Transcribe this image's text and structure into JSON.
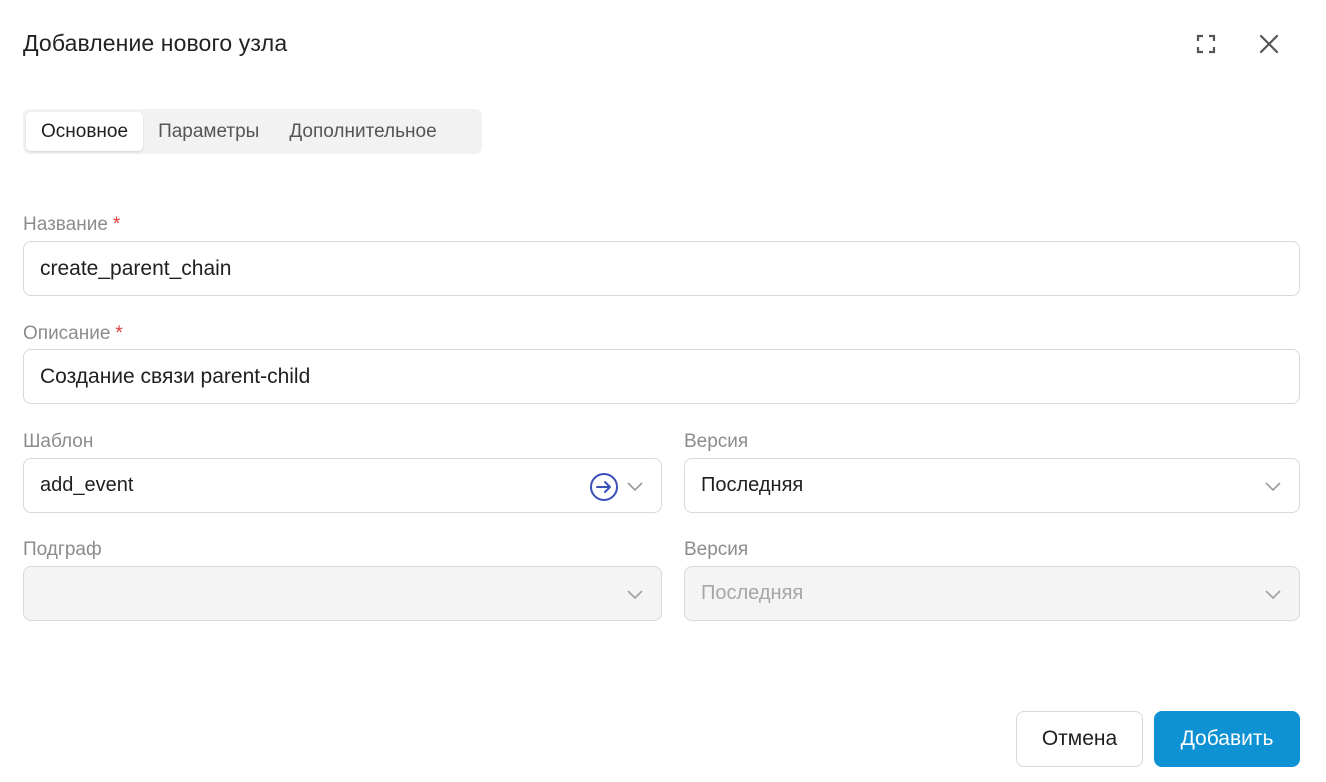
{
  "dialog": {
    "title": "Добавление нового узла"
  },
  "icons": {
    "expand": "expand-icon",
    "close": "close-icon",
    "navigate": "arrow-circle-right-icon",
    "chevron": "chevron-down-icon"
  },
  "tabs": [
    {
      "label": "Основное",
      "active": true
    },
    {
      "label": "Параметры",
      "active": false
    },
    {
      "label": "Дополнительное",
      "active": false
    }
  ],
  "form": {
    "name": {
      "label": "Название",
      "required_mark": "*",
      "value": "create_parent_chain"
    },
    "description": {
      "label": "Описание",
      "required_mark": "*",
      "value": "Создание связи parent-child"
    },
    "template": {
      "label": "Шаблон",
      "value": "add_event"
    },
    "template_version": {
      "label": "Версия",
      "value": "Последняя"
    },
    "subgraph": {
      "label": "Подграф",
      "value": ""
    },
    "subgraph_version": {
      "label": "Версия",
      "value": "Последняя"
    }
  },
  "footer": {
    "cancel_label": "Отмена",
    "submit_label": "Добавить"
  },
  "colors": {
    "primary": "#0e92d4",
    "required": "#e03a3a",
    "navigate_icon": "#3a4fb8"
  }
}
